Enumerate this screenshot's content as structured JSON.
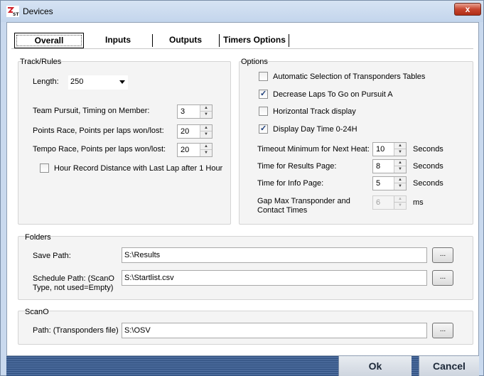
{
  "window": {
    "title": "Devices",
    "close_label": "x"
  },
  "tabs": [
    {
      "label": "Overall",
      "active": true
    },
    {
      "label": "Inputs",
      "active": false
    },
    {
      "label": "Outputs",
      "active": false
    },
    {
      "label": "Timers Options",
      "active": false
    }
  ],
  "track_rules": {
    "title": "Track/Rules",
    "length_label": "Length:",
    "length_value": "250",
    "team_pursuit_label": "Team Pursuit, Timing on Member:",
    "team_pursuit_value": "3",
    "points_race_label": "Points Race, Points per laps won/lost:",
    "points_race_value": "20",
    "tempo_race_label": "Tempo Race, Points per laps won/lost:",
    "tempo_race_value": "20",
    "hour_record_label": "Hour Record Distance with Last Lap after 1 Hour",
    "hour_record_checked": false
  },
  "options": {
    "title": "Options",
    "checkboxes": [
      {
        "label": "Automatic Selection of Transponders Tables",
        "checked": false
      },
      {
        "label": "Decrease Laps To Go on Pursuit A",
        "checked": true
      },
      {
        "label": "Horizontal Track display",
        "checked": false
      },
      {
        "label": "Display Day Time 0-24H",
        "checked": true
      }
    ],
    "timeout_label": "Timeout Minimum for Next Heat:",
    "timeout_value": "10",
    "timeout_unit": "Seconds",
    "results_label": "Time for Results Page:",
    "results_value": "8",
    "results_unit": "Seconds",
    "info_label": "Time for Info Page:",
    "info_value": "5",
    "info_unit": "Seconds",
    "gap_label_1": "Gap Max Transponder and",
    "gap_label_2": "Contact Times",
    "gap_value": "6",
    "gap_unit": "ms"
  },
  "folders": {
    "title": "Folders",
    "save_label": "Save Path:",
    "save_value": "S:\\Results",
    "schedule_label_1": "Schedule Path: (ScanO",
    "schedule_label_2": "Type, not used=Empty)",
    "schedule_value": "S:\\Startlist.csv",
    "browse_label": "..."
  },
  "scano": {
    "title": "ScanO",
    "path_label": "Path: (Transponders file)",
    "path_value": "S:\\OSV",
    "browse_label": "..."
  },
  "footer": {
    "ok_label": "Ok",
    "cancel_label": "Cancel"
  }
}
